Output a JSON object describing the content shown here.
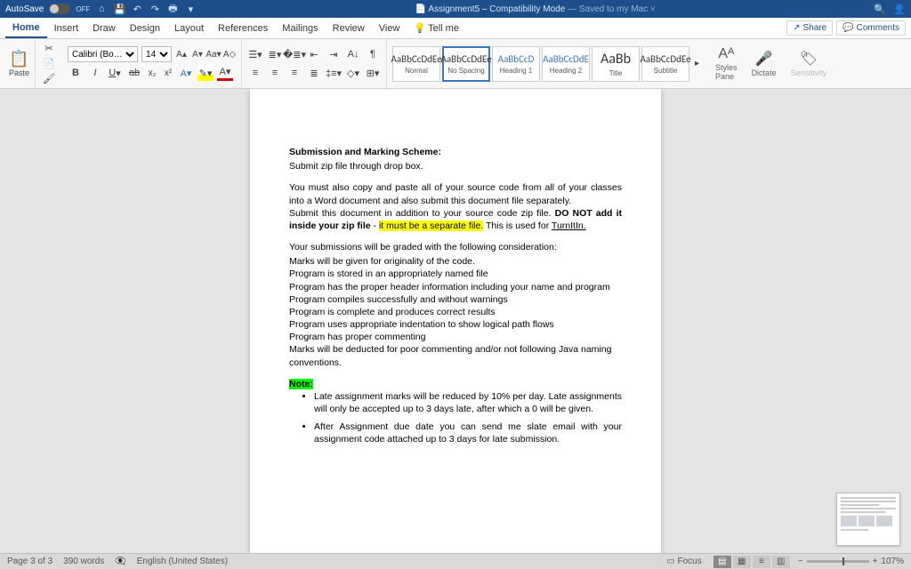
{
  "titlebar": {
    "autosave_label": "AutoSave",
    "autosave_state": "OFF",
    "doc_icon": "W",
    "title_prefix": "📄",
    "title": "Assignment5  –  Compatibility Mode",
    "title_suffix": " — Saved to my Mac"
  },
  "tabs": {
    "items": [
      "Home",
      "Insert",
      "Draw",
      "Design",
      "Layout",
      "References",
      "Mailings",
      "Review",
      "View"
    ],
    "tellme": "Tell me",
    "share": "Share",
    "comments": "Comments"
  },
  "ribbon": {
    "paste": "Paste",
    "font_name": "Calibri (Bo…",
    "font_size": "14",
    "styles": [
      {
        "preview": "AaBbCcDdEe",
        "label": "Normal",
        "cls": ""
      },
      {
        "preview": "AaBbCcDdEe",
        "label": "No Spacing",
        "cls": "sel"
      },
      {
        "preview": "AaBbCcD",
        "label": "Heading 1",
        "cls": "",
        "pv": "heading"
      },
      {
        "preview": "AaBbCcDdE",
        "label": "Heading 2",
        "cls": "",
        "pv": "heading"
      },
      {
        "preview": "AaBb",
        "label": "Title",
        "cls": "",
        "pv": "title"
      },
      {
        "preview": "AaBbCcDdEe",
        "label": "Subtitle",
        "cls": ""
      }
    ],
    "styles_pane": "Styles\nPane",
    "dictate": "Dictate",
    "sensitivity": "Sensitivity"
  },
  "document": {
    "heading": "Submission and Marking Scheme:",
    "line1": "Submit zip file through drop box.",
    "p2a": "You must also copy and paste all of your source code from all of your classes into a Word document and also submit this document file separately.",
    "p2b_pre": "Submit this document in addition to your source code zip file. ",
    "p2b_bold1": "DO NOT add it inside your zip file",
    "p2b_mid": " - ",
    "p2b_hl": "it must be a separate file.",
    "p2b_post": " This is used for ",
    "p2b_link": "TurnItIn.",
    "p3": "Your submissions will be graded with the following consideration:",
    "lines": [
      "Marks will be given for originality of the code.",
      "Program is stored in an appropriately named file",
      "Program has the proper header information including your name and program",
      "Program compiles successfully and without warnings",
      "Program is complete and produces correct results",
      "Program uses appropriate indentation to show logical path flows",
      "Program has proper commenting",
      "Marks will be deducted for poor commenting and/or not following Java naming conventions."
    ],
    "note": "Note:",
    "bullets": [
      "Late assignment marks will be reduced by 10% per day.  Late assignments will only be accepted up to 3 days late, after which a 0 will be given.",
      "After Assignment due date you can send me slate email with your assignment code attached up to 3 days for late submission."
    ]
  },
  "statusbar": {
    "page": "Page 3 of 3",
    "words": "390 words",
    "lang": "English (United States)",
    "focus": "Focus",
    "zoom": "107%"
  }
}
